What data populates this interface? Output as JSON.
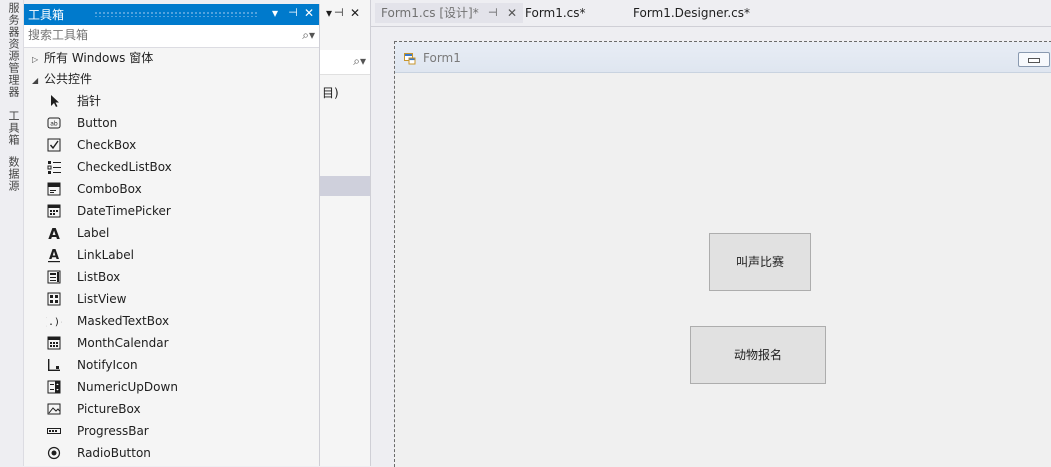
{
  "left_strip": {
    "tabs": [
      "服务器资源管理器",
      "工具箱",
      "数据源"
    ]
  },
  "toolbox": {
    "title": "工具箱",
    "search_placeholder": "搜索工具箱",
    "categories": [
      {
        "label": "所有 Windows 窗体",
        "expanded": false
      },
      {
        "label": "公共控件",
        "expanded": true
      }
    ],
    "items": [
      {
        "label": "指针",
        "icon": "pointer-icon"
      },
      {
        "label": "Button",
        "icon": "button-icon"
      },
      {
        "label": "CheckBox",
        "icon": "checkbox-icon"
      },
      {
        "label": "CheckedListBox",
        "icon": "checkedlistbox-icon"
      },
      {
        "label": "ComboBox",
        "icon": "combobox-icon"
      },
      {
        "label": "DateTimePicker",
        "icon": "datetimepicker-icon"
      },
      {
        "label": "Label",
        "icon": "label-icon"
      },
      {
        "label": "LinkLabel",
        "icon": "linklabel-icon"
      },
      {
        "label": "ListBox",
        "icon": "listbox-icon"
      },
      {
        "label": "ListView",
        "icon": "listview-icon"
      },
      {
        "label": "MaskedTextBox",
        "icon": "maskedtextbox-icon"
      },
      {
        "label": "MonthCalendar",
        "icon": "monthcalendar-icon"
      },
      {
        "label": "NotifyIcon",
        "icon": "notifyicon-icon"
      },
      {
        "label": "NumericUpDown",
        "icon": "numericupdown-icon"
      },
      {
        "label": "PictureBox",
        "icon": "picturebox-icon"
      },
      {
        "label": "ProgressBar",
        "icon": "progressbar-icon"
      },
      {
        "label": "RadioButton",
        "icon": "radiobutton-icon"
      }
    ]
  },
  "mid_panel": {
    "partial_text": "目)"
  },
  "tabs": [
    {
      "label": "Form1.cs [设计]*",
      "active": true
    },
    {
      "label": "Form1.cs*",
      "active": false
    },
    {
      "label": "Form1.Designer.cs*",
      "active": false
    }
  ],
  "form": {
    "title": "Form1",
    "buttons": {
      "contest": "叫声比赛",
      "signup": "动物报名"
    }
  },
  "colors": {
    "accent": "#007acc",
    "toolbox_bg": "#f5f5f5",
    "form_bg": "#f0f0f0"
  }
}
